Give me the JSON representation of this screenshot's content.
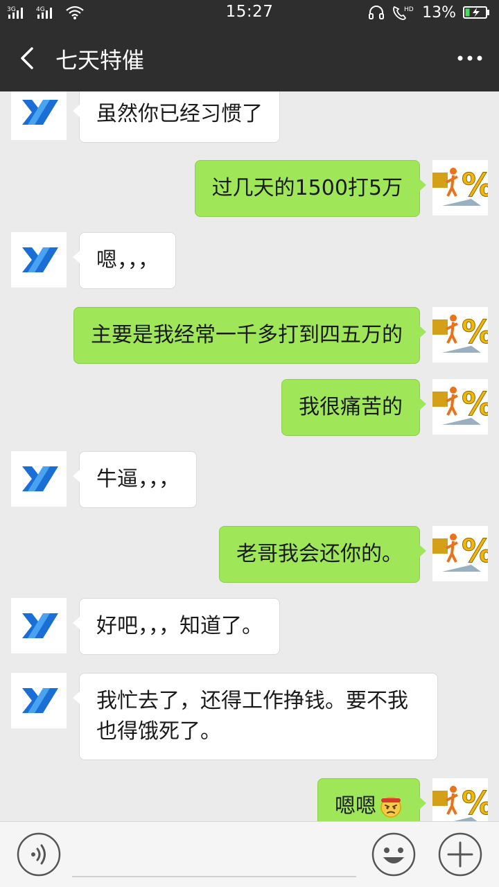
{
  "status_bar": {
    "network_1": "3G",
    "network_2": "4G",
    "time": "15:27",
    "hd_label": "HD",
    "battery": "13%"
  },
  "header": {
    "title": "七天特催",
    "back_icon": "back-arrow-icon",
    "more_icon": "more-dots-icon"
  },
  "messages": [
    {
      "side": "in",
      "text": "虽然你已经习惯了"
    },
    {
      "side": "out",
      "text": "过几天的1500打5万"
    },
    {
      "side": "in",
      "text": "嗯，，，"
    },
    {
      "side": "out",
      "text": "主要是我经常一千多打到四五万的"
    },
    {
      "side": "out",
      "text": "我很痛苦的"
    },
    {
      "side": "in",
      "text": "牛逼，，，"
    },
    {
      "side": "out",
      "text": "老哥我会还你的。"
    },
    {
      "side": "in",
      "text": "好吧，，，知道了。"
    },
    {
      "side": "in",
      "text": "我忙去了，还得工作挣钱。要不我也得饿死了。"
    },
    {
      "side": "out",
      "text": "嗯嗯",
      "emoji": "angry-face-emoji"
    }
  ],
  "input_bar": {
    "voice_icon": "voice-icon",
    "input_value": "",
    "emoji_icon": "smiley-icon",
    "plus_icon": "plus-icon"
  },
  "colors": {
    "bar_bg": "#2e2e2e",
    "chat_bg": "#ebebeb",
    "outgoing_bubble": "#9fe658",
    "incoming_bubble": "#ffffff",
    "battery_green": "#4cd964",
    "avatar_blue": "#1b6ed6"
  }
}
